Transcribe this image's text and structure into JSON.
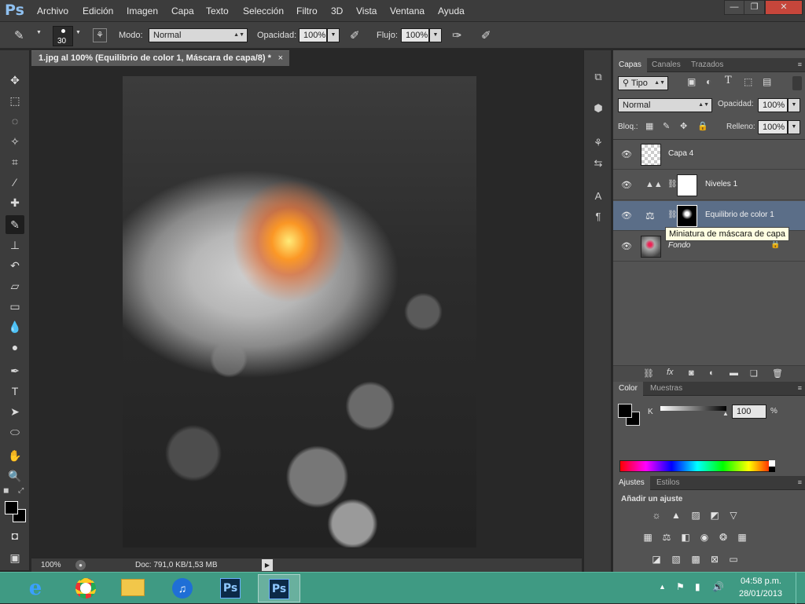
{
  "app": {
    "logo": "Ps"
  },
  "menubar": {
    "items": [
      "Archivo",
      "Edición",
      "Imagen",
      "Capa",
      "Texto",
      "Selección",
      "Filtro",
      "3D",
      "Vista",
      "Ventana",
      "Ayuda"
    ],
    "window_controls": {
      "minimize": "—",
      "restore": "❐",
      "close": "✕"
    }
  },
  "options": {
    "brush_size": "30",
    "mode_label": "Modo:",
    "mode_value": "Normal",
    "opacity_label": "Opacidad:",
    "opacity_value": "100%",
    "flow_label": "Flujo:",
    "flow_value": "100%"
  },
  "document": {
    "tab_title": "1.jpg al 100% (Equilibrio de color 1, Máscara de capa/8) *",
    "tab_close": "×"
  },
  "status": {
    "zoom": "100%",
    "doc_info": "Doc: 791,0 KB/1,53 MB"
  },
  "layers_panel": {
    "tabs": [
      "Capas",
      "Canales",
      "Trazados"
    ],
    "filter_kind": "Tipo",
    "blend_mode": "Normal",
    "opacity_label": "Opacidad:",
    "opacity_value": "100%",
    "lock_label": "Bloq.:",
    "fill_label": "Relleno:",
    "fill_value": "100%",
    "layers": [
      {
        "name": "Capa 4",
        "selected": false
      },
      {
        "name": "Niveles 1",
        "selected": false
      },
      {
        "name": "Equilibrio de color 1",
        "selected": true
      },
      {
        "name": "Fondo",
        "selected": false
      }
    ],
    "tooltip": "Miniatura de máscara de capa",
    "footer_icons": [
      "link-icon",
      "fx-icon",
      "mask-icon",
      "adjustment-icon",
      "folder-icon",
      "new-layer-icon",
      "trash-icon"
    ]
  },
  "color_panel": {
    "tabs": [
      "Color",
      "Muestras"
    ],
    "channel_label": "K",
    "channel_value": "100",
    "percent": "%"
  },
  "adjustments_panel": {
    "tabs": [
      "Ajustes",
      "Estilos"
    ],
    "heading": "Añadir un ajuste"
  },
  "taskbar": {
    "time": "04:58 p.m.",
    "date": "28/01/2013",
    "ps_label": "Ps"
  },
  "colors": {
    "accent": "#5b6e88",
    "taskbar": "#3f9a83",
    "ps_blue": "#8fc0f0"
  }
}
